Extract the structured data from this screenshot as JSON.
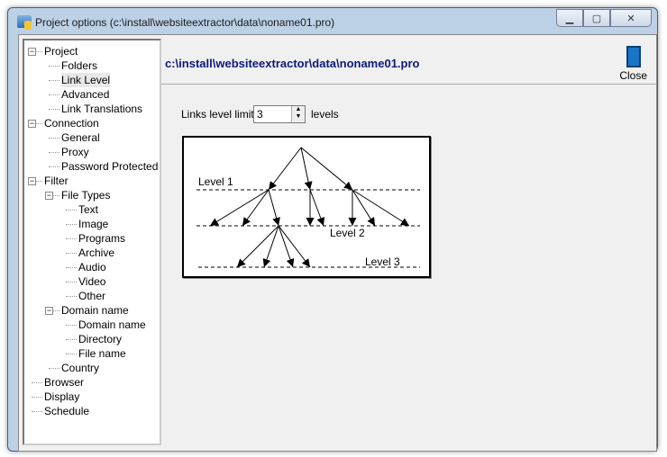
{
  "window": {
    "title": "Project options (c:\\install\\websiteextractor\\data\\noname01.pro)"
  },
  "header": {
    "path": "c:\\install\\websiteextractor\\data\\noname01.pro",
    "close_label": "Close"
  },
  "tree": [
    {
      "label": "Project",
      "level": 0,
      "exp": "-"
    },
    {
      "label": "Folders",
      "level": 1
    },
    {
      "label": "Link Level",
      "level": 1,
      "selected": true
    },
    {
      "label": "Advanced",
      "level": 1
    },
    {
      "label": "Link Translations",
      "level": 1
    },
    {
      "label": "Connection",
      "level": 0,
      "exp": "-"
    },
    {
      "label": "General",
      "level": 1
    },
    {
      "label": "Proxy",
      "level": 1
    },
    {
      "label": "Password Protected",
      "level": 1
    },
    {
      "label": "Filter",
      "level": 0,
      "exp": "-"
    },
    {
      "label": "File Types",
      "level": 1,
      "exp": "-"
    },
    {
      "label": "Text",
      "level": 2
    },
    {
      "label": "Image",
      "level": 2
    },
    {
      "label": "Programs",
      "level": 2
    },
    {
      "label": "Archive",
      "level": 2
    },
    {
      "label": "Audio",
      "level": 2
    },
    {
      "label": "Video",
      "level": 2
    },
    {
      "label": "Other",
      "level": 2
    },
    {
      "label": "Domain name",
      "level": 1,
      "exp": "-"
    },
    {
      "label": "Domain name",
      "level": 2
    },
    {
      "label": "Directory",
      "level": 2
    },
    {
      "label": "File name",
      "level": 2
    },
    {
      "label": "Country",
      "level": 1
    },
    {
      "label": "Browser",
      "level": 0
    },
    {
      "label": "Display",
      "level": 0
    },
    {
      "label": "Schedule",
      "level": 0
    }
  ],
  "links": {
    "label": "Links level limit",
    "value": "3",
    "suffix": "levels"
  },
  "diagram": {
    "level1": "Level 1",
    "level2": "Level 2",
    "level3": "Level 3"
  }
}
